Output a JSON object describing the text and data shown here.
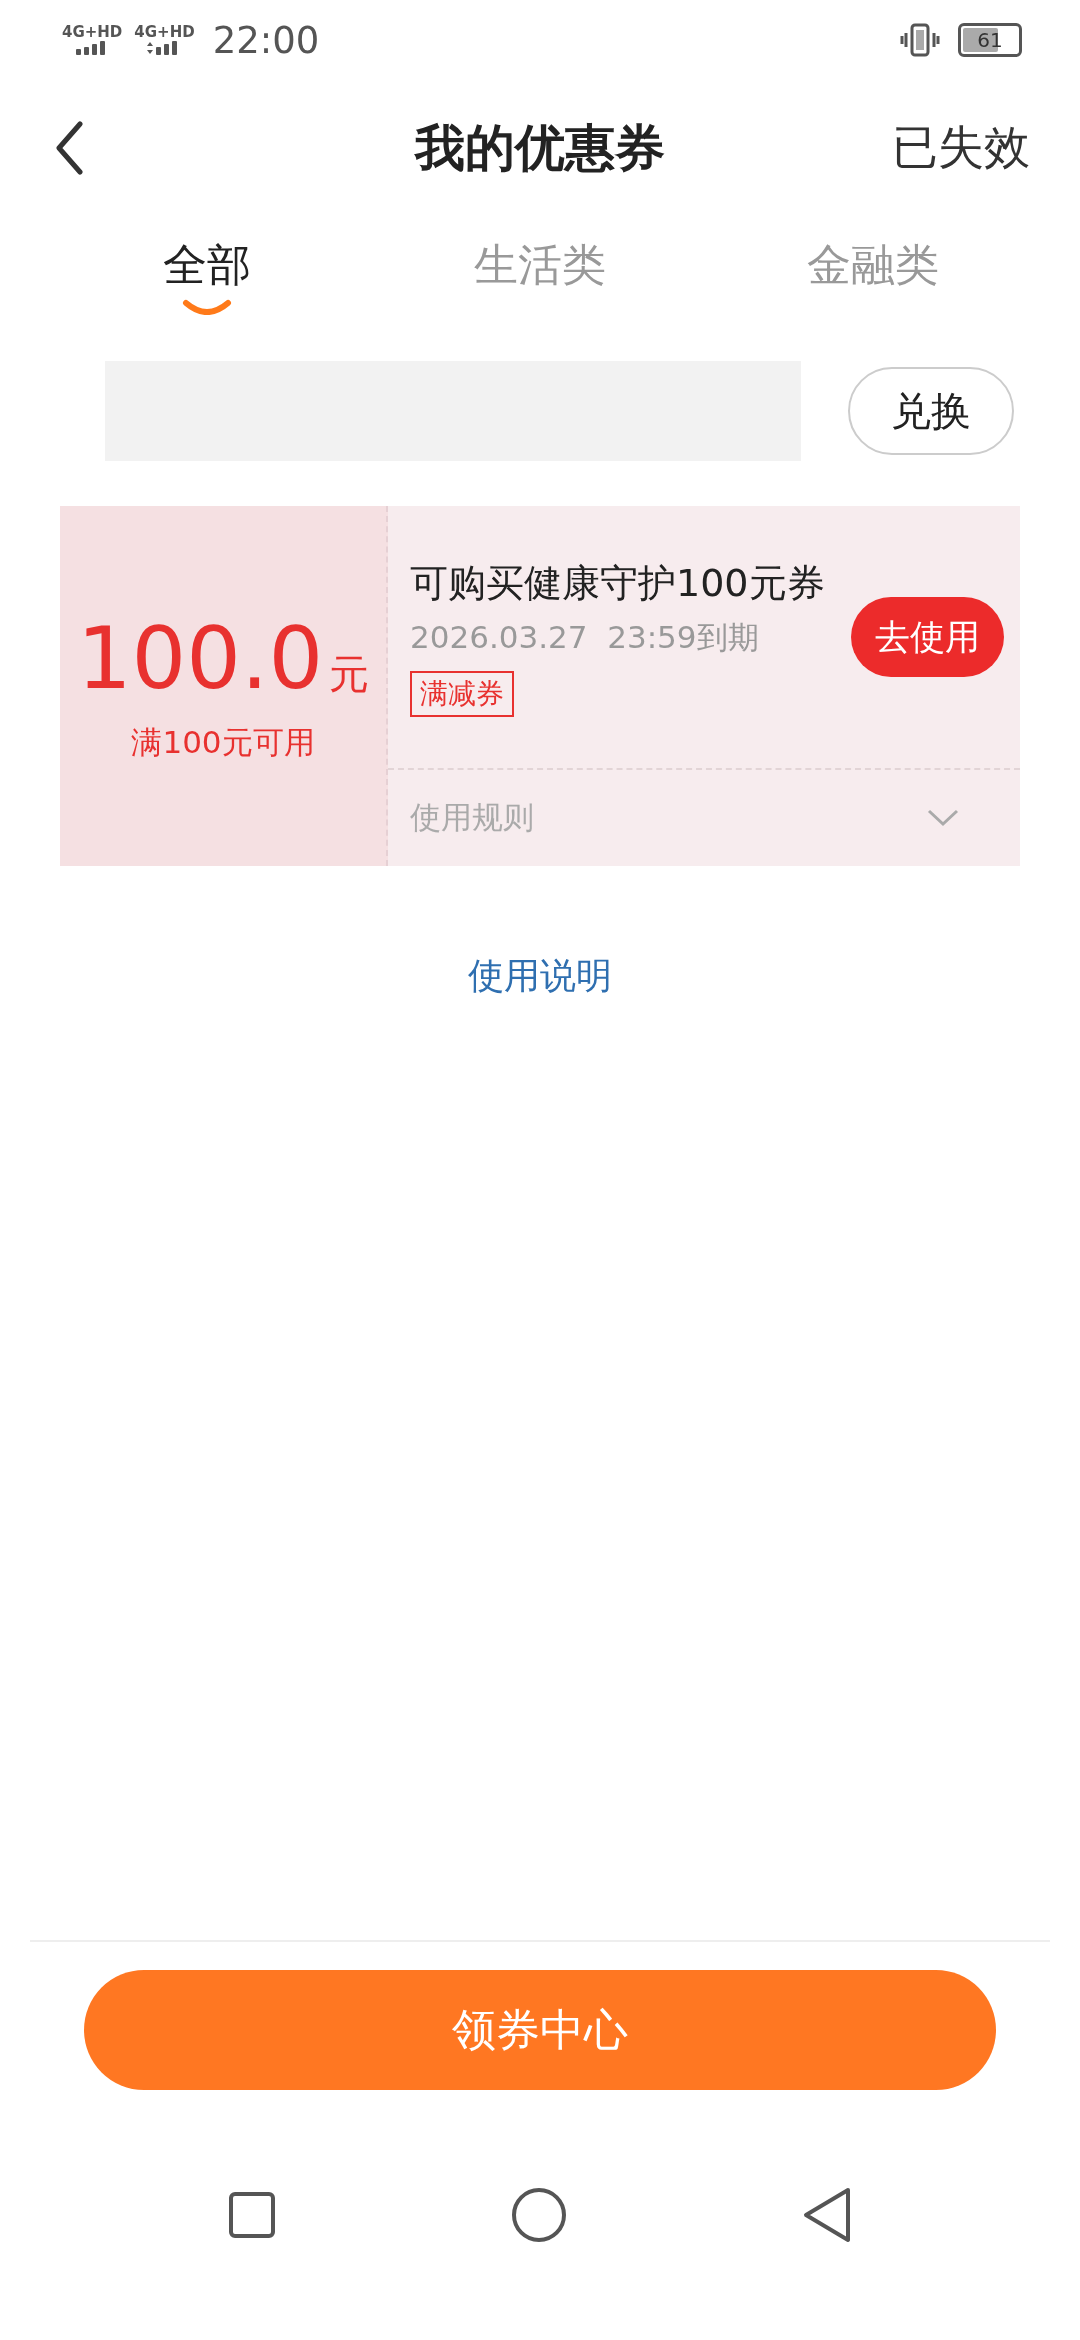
{
  "status_bar": {
    "network_1": "4G+HD",
    "network_2": "4G+HD",
    "time": "22:00",
    "battery": "61"
  },
  "header": {
    "title": "我的优惠券",
    "action": "已失效"
  },
  "tabs": [
    {
      "label": "全部",
      "selected": true
    },
    {
      "label": "生活类",
      "selected": false
    },
    {
      "label": "金融类",
      "selected": false
    }
  ],
  "redeem": {
    "button": "兑换"
  },
  "coupons": [
    {
      "amount": "100.0",
      "unit": "元",
      "condition": "满100元可用",
      "title": "可购买健康守护100元券",
      "expiry": "2026.03.27  23:59到期",
      "tag": "满减券",
      "button": "去使用",
      "rules_label": "使用规则",
      "expanded": false
    }
  ],
  "help_link": "使用说明",
  "bottom_button": "领券中心"
}
